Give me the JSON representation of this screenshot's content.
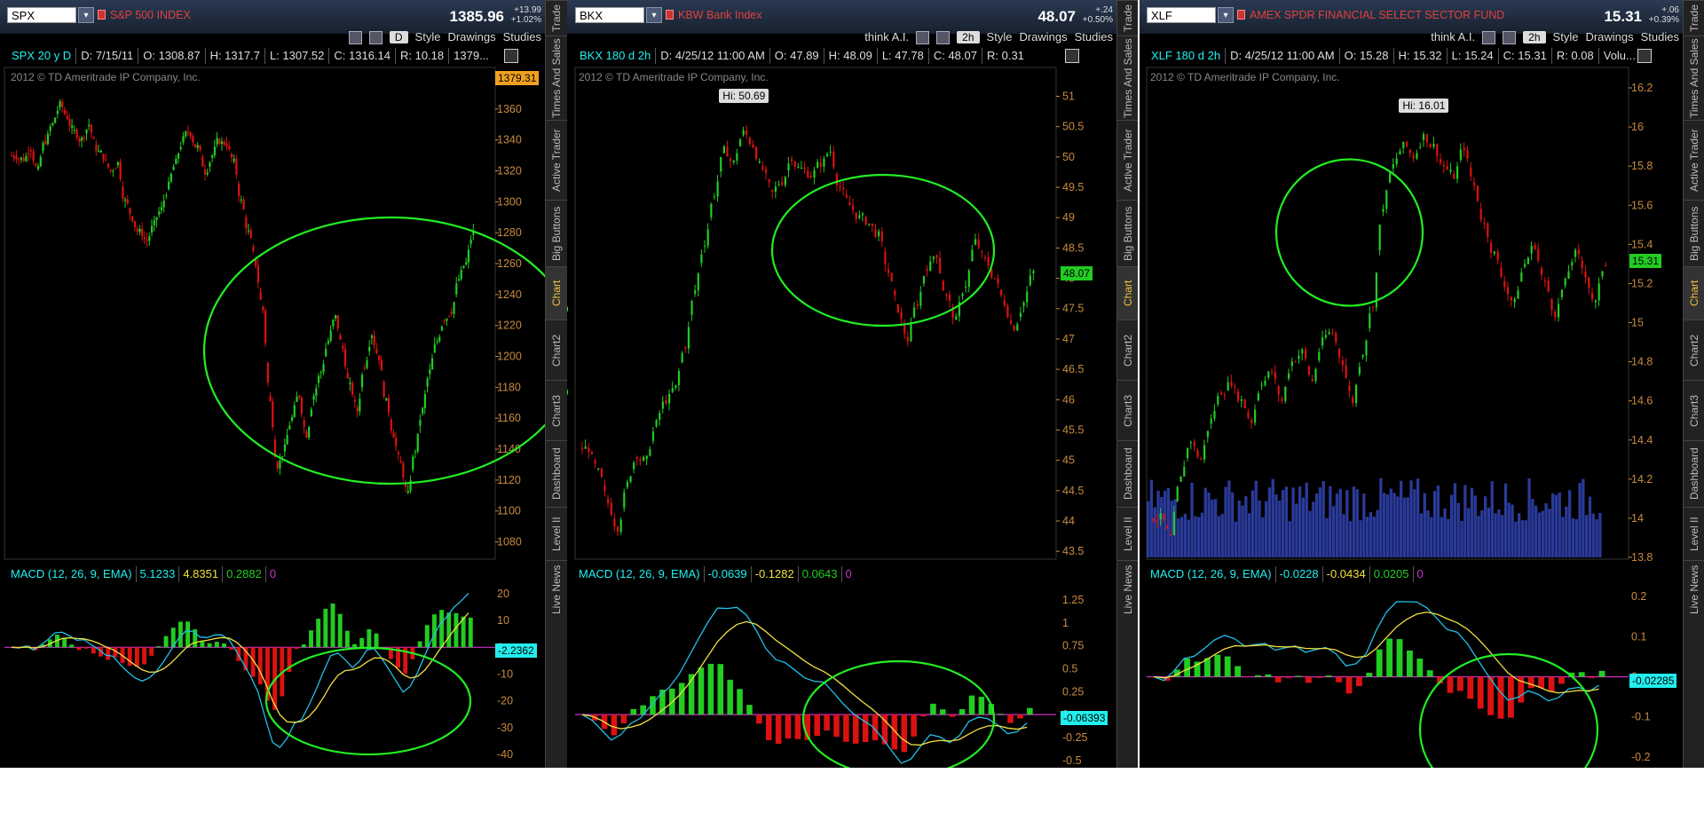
{
  "panels": [
    {
      "symbol": "SPX",
      "description": "S&P 500 INDEX",
      "last": "1385.96",
      "change_abs": "+13.99",
      "change_pct": "+1.02%",
      "toolbar": {
        "think_ai": "",
        "aggregation": "D",
        "style": "Style",
        "drawings": "Drawings",
        "studies": "Studies"
      },
      "info": {
        "title": "SPX 20 y D",
        "date": "D: 7/15/11",
        "open": "O: 1308.87",
        "high": "H: 1317.7",
        "low": "L: 1307.52",
        "close": "C: 1316.14",
        "range": "R: 10.18",
        "extra": "1379..."
      },
      "copyright": "2012 © TD Ameritrade IP Company, Inc.",
      "price_box": "1379.31",
      "price_box_color": "#f0a020",
      "hi_label": "",
      "price_axis": [
        "1360",
        "1340",
        "1320",
        "1300",
        "1280",
        "1260",
        "1240",
        "1220",
        "1200",
        "1180",
        "1160",
        "1140",
        "1120",
        "1100",
        "1080"
      ],
      "macd": {
        "label": "MACD (12, 26, 9, EMA)",
        "value": "5.1233",
        "avg": "4.8351",
        "diff": "0.2882",
        "zero": "0",
        "box": "-2.2362",
        "axis": [
          "20",
          "10",
          "0",
          "-10",
          "-20",
          "-30",
          "-40"
        ]
      }
    },
    {
      "symbol": "BKX",
      "description": "KBW Bank Index",
      "last": "48.07",
      "change_abs": "+.24",
      "change_pct": "+0.50%",
      "toolbar": {
        "think_ai": "think A.I.",
        "aggregation": "2h",
        "style": "Style",
        "drawings": "Drawings",
        "studies": "Studies"
      },
      "info": {
        "title": "BKX 180 d 2h",
        "date": "D: 4/25/12 11:00 AM",
        "open": "O: 47.89",
        "high": "H: 48.09",
        "low": "L: 47.78",
        "close": "C: 48.07",
        "range": "R: 0.31",
        "extra": ""
      },
      "copyright": "2012 © TD Ameritrade IP Company, Inc.",
      "price_box": "48.07",
      "price_box_color": "#22cc22",
      "hi_label": "Hi: 50.69",
      "price_axis": [
        "51",
        "50.5",
        "50",
        "49.5",
        "49",
        "48.5",
        "48",
        "47.5",
        "47",
        "46.5",
        "46",
        "45.5",
        "45",
        "44.5",
        "44",
        "43.5"
      ],
      "macd": {
        "label": "MACD (12, 26, 9, EMA)",
        "value": "-0.0639",
        "avg": "-0.1282",
        "diff": "0.0643",
        "zero": "0",
        "box": "-0.06393",
        "axis": [
          "1.25",
          "1",
          "0.75",
          "0.5",
          "0.25",
          "0",
          "-0.25",
          "-0.5"
        ]
      }
    },
    {
      "symbol": "XLF",
      "description": "AMEX SPDR FINANCIAL SELECT SECTOR FUND",
      "last": "15.31",
      "change_abs": "+.06",
      "change_pct": "+0.39%",
      "toolbar": {
        "think_ai": "think A.I.",
        "aggregation": "2h",
        "style": "Style",
        "drawings": "Drawings",
        "studies": "Studies"
      },
      "info": {
        "title": "XLF 180 d 2h",
        "date": "D: 4/25/12 11:00 AM",
        "open": "O: 15.28",
        "high": "H: 15.32",
        "low": "L: 15.24",
        "close": "C: 15.31",
        "range": "R: 0.08",
        "extra": "Volu..."
      },
      "copyright": "2012 © TD Ameritrade IP Company, Inc.",
      "price_box": "15.31",
      "price_box_color": "#22cc22",
      "hi_label": "Hi: 16.01",
      "price_axis": [
        "16.2",
        "16",
        "15.8",
        "15.6",
        "15.4",
        "15.2",
        "15",
        "14.8",
        "14.6",
        "14.4",
        "14.2",
        "14",
        "13.8"
      ],
      "macd": {
        "label": "MACD (12, 26, 9, EMA)",
        "value": "-0.0228",
        "avg": "-0.0434",
        "diff": "0.0205",
        "zero": "0",
        "box": "-0.02285",
        "axis": [
          "0.2",
          "0.1",
          "0",
          "-0.1",
          "-0.2"
        ]
      }
    }
  ],
  "sidebar_tabs": [
    "Trade",
    "Times And Sales",
    "Active Trader",
    "Big Buttons",
    "Chart",
    "Chart2",
    "Chart3",
    "Dashboard",
    "Level II",
    "Live News"
  ],
  "sidebar_active": "Chart",
  "colors": {
    "up": "#22cc22",
    "down": "#dd1111",
    "macd": "#22c0e8",
    "avg": "#f0e040",
    "diff_up": "#22cc22",
    "diff_down": "#dd1111",
    "zero": "#cc33cc",
    "annotation": "#22ee22",
    "volume": "#2a3a9a"
  },
  "chart_data": [
    {
      "type": "candlestick",
      "title": "SPX 20 y D",
      "ylim": [
        1070,
        1380
      ],
      "close": [
        1330,
        1328,
        1335,
        1320,
        1340,
        1350,
        1362,
        1355,
        1345,
        1340,
        1350,
        1335,
        1330,
        1320,
        1325,
        1300,
        1290,
        1280,
        1275,
        1285,
        1295,
        1310,
        1325,
        1340,
        1345,
        1335,
        1320,
        1330,
        1340,
        1338,
        1325,
        1300,
        1280,
        1260,
        1230,
        1170,
        1130,
        1140,
        1160,
        1175,
        1150,
        1175,
        1190,
        1210,
        1225,
        1205,
        1180,
        1165,
        1195,
        1215,
        1200,
        1170,
        1150,
        1130,
        1110,
        1140,
        1165,
        1190,
        1210,
        1225,
        1230,
        1250,
        1260,
        1280
      ]
    },
    {
      "type": "candlestick",
      "title": "BKX 180 d 2h",
      "ylim": [
        43.4,
        51.3
      ],
      "close": [
        45.2,
        44.8,
        44.3,
        43.9,
        44.6,
        45.1,
        45.0,
        45.6,
        46.0,
        46.2,
        46.9,
        47.8,
        48.6,
        49.4,
        50.1,
        49.9,
        50.4,
        50.2,
        49.8,
        49.4,
        49.6,
        50.0,
        49.8,
        49.7,
        49.9,
        50.1,
        49.5,
        49.2,
        49.0,
        48.9,
        48.7,
        48.1,
        47.5,
        47.0,
        47.6,
        48.2,
        48.4,
        47.7,
        47.3,
        47.9,
        48.6,
        48.3,
        48.0,
        47.6,
        47.2,
        47.6,
        48.1
      ],
      "hi": 50.69
    },
    {
      "type": "candlestick",
      "title": "XLF 180 d 2h",
      "ylim": [
        13.8,
        16.25
      ],
      "close": [
        14.0,
        13.9,
        14.2,
        14.4,
        14.3,
        14.5,
        14.65,
        14.7,
        14.6,
        14.5,
        14.7,
        14.75,
        14.6,
        14.8,
        14.85,
        14.7,
        14.9,
        14.95,
        14.8,
        14.6,
        14.85,
        15.1,
        15.6,
        15.8,
        15.9,
        15.85,
        15.95,
        15.9,
        15.8,
        15.75,
        15.9,
        15.7,
        15.5,
        15.35,
        15.2,
        15.1,
        15.3,
        15.4,
        15.2,
        15.05,
        15.2,
        15.35,
        15.25,
        15.1,
        15.31
      ],
      "hi": 16.01
    }
  ]
}
